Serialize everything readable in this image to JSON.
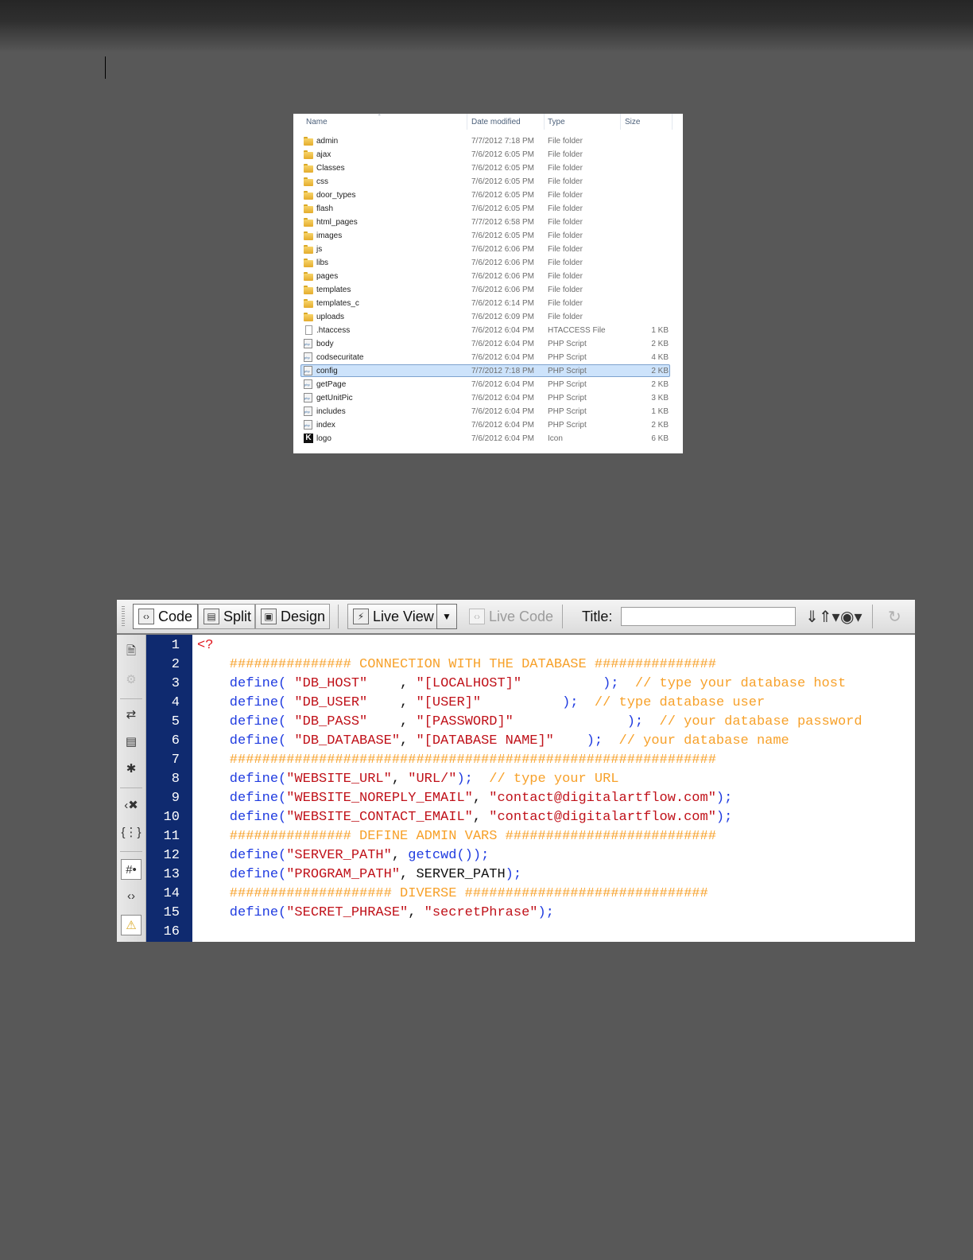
{
  "explorer": {
    "columns": [
      "Name",
      "Date modified",
      "Type",
      "Size"
    ],
    "rows": [
      {
        "name": "admin",
        "date": "7/7/2012 7:18 PM",
        "type": "File folder",
        "size": "",
        "icon": "folder-icon"
      },
      {
        "name": "ajax",
        "date": "7/6/2012 6:05 PM",
        "type": "File folder",
        "size": "",
        "icon": "folder-icon"
      },
      {
        "name": "Classes",
        "date": "7/6/2012 6:05 PM",
        "type": "File folder",
        "size": "",
        "icon": "folder-icon"
      },
      {
        "name": "css",
        "date": "7/6/2012 6:05 PM",
        "type": "File folder",
        "size": "",
        "icon": "folder-icon"
      },
      {
        "name": "door_types",
        "date": "7/6/2012 6:05 PM",
        "type": "File folder",
        "size": "",
        "icon": "folder-icon"
      },
      {
        "name": "flash",
        "date": "7/6/2012 6:05 PM",
        "type": "File folder",
        "size": "",
        "icon": "folder-icon"
      },
      {
        "name": "html_pages",
        "date": "7/7/2012 6:58 PM",
        "type": "File folder",
        "size": "",
        "icon": "folder-icon"
      },
      {
        "name": "images",
        "date": "7/6/2012 6:05 PM",
        "type": "File folder",
        "size": "",
        "icon": "folder-icon"
      },
      {
        "name": "js",
        "date": "7/6/2012 6:06 PM",
        "type": "File folder",
        "size": "",
        "icon": "folder-icon"
      },
      {
        "name": "libs",
        "date": "7/6/2012 6:06 PM",
        "type": "File folder",
        "size": "",
        "icon": "folder-icon"
      },
      {
        "name": "pages",
        "date": "7/6/2012 6:06 PM",
        "type": "File folder",
        "size": "",
        "icon": "folder-icon"
      },
      {
        "name": "templates",
        "date": "7/6/2012 6:06 PM",
        "type": "File folder",
        "size": "",
        "icon": "folder-icon"
      },
      {
        "name": "templates_c",
        "date": "7/6/2012 6:14 PM",
        "type": "File folder",
        "size": "",
        "icon": "folder-icon"
      },
      {
        "name": "uploads",
        "date": "7/6/2012 6:09 PM",
        "type": "File folder",
        "size": "",
        "icon": "folder-icon"
      },
      {
        "name": ".htaccess",
        "date": "7/6/2012 6:04 PM",
        "type": "HTACCESS File",
        "size": "1 KB",
        "icon": "file-icon"
      },
      {
        "name": "body",
        "date": "7/6/2012 6:04 PM",
        "type": "PHP Script",
        "size": "2 KB",
        "icon": "php-file-icon"
      },
      {
        "name": "codsecuritate",
        "date": "7/6/2012 6:04 PM",
        "type": "PHP Script",
        "size": "4 KB",
        "icon": "php-file-icon"
      },
      {
        "name": "config",
        "date": "7/7/2012 7:18 PM",
        "type": "PHP Script",
        "size": "2 KB",
        "icon": "php-file-icon",
        "selected": true
      },
      {
        "name": "getPage",
        "date": "7/6/2012 6:04 PM",
        "type": "PHP Script",
        "size": "2 KB",
        "icon": "php-file-icon"
      },
      {
        "name": "getUnitPic",
        "date": "7/6/2012 6:04 PM",
        "type": "PHP Script",
        "size": "3 KB",
        "icon": "php-file-icon"
      },
      {
        "name": "includes",
        "date": "7/6/2012 6:04 PM",
        "type": "PHP Script",
        "size": "1 KB",
        "icon": "php-file-icon"
      },
      {
        "name": "index",
        "date": "7/6/2012 6:04 PM",
        "type": "PHP Script",
        "size": "2 KB",
        "icon": "php-file-icon"
      },
      {
        "name": "logo",
        "date": "7/6/2012 6:04 PM",
        "type": "Icon",
        "size": "6 KB",
        "icon": "logo-icon"
      }
    ]
  },
  "toolbar": {
    "code_label": "Code",
    "split_label": "Split",
    "design_label": "Design",
    "live_view_label": "Live View",
    "live_code_label": "Live Code",
    "title_label": "Title:",
    "title_value": ""
  },
  "editor": {
    "line_numbers": [
      "1",
      "2",
      "3",
      "4",
      "5",
      "6",
      "7",
      "8",
      "9",
      "10",
      "11",
      "12",
      "13",
      "14",
      "15",
      "16"
    ],
    "lines": [
      [
        {
          "t": "tag",
          "v": "<?"
        }
      ],
      [
        {
          "t": "cm",
          "v": "    ############### CONNECTION WITH THE DATABASE ###############"
        }
      ],
      [
        {
          "t": "kw",
          "v": "    define( "
        },
        {
          "t": "str",
          "v": "\"DB_HOST\""
        },
        {
          "t": "pl",
          "v": "    , "
        },
        {
          "t": "str",
          "v": "\"[LOCALHOST]\""
        },
        {
          "t": "kw",
          "v": "          );"
        },
        {
          "t": "cm",
          "v": "  // type your database host"
        }
      ],
      [
        {
          "t": "kw",
          "v": "    define( "
        },
        {
          "t": "str",
          "v": "\"DB_USER\""
        },
        {
          "t": "pl",
          "v": "    , "
        },
        {
          "t": "str",
          "v": "\"[USER]\""
        },
        {
          "t": "kw",
          "v": "          );"
        },
        {
          "t": "cm",
          "v": "  // type database user"
        }
      ],
      [
        {
          "t": "kw",
          "v": "    define( "
        },
        {
          "t": "str",
          "v": "\"DB_PASS\""
        },
        {
          "t": "pl",
          "v": "    , "
        },
        {
          "t": "str",
          "v": "\"[PASSWORD]\""
        },
        {
          "t": "kw",
          "v": "              );"
        },
        {
          "t": "cm",
          "v": "  // your database password"
        }
      ],
      [
        {
          "t": "kw",
          "v": "    define( "
        },
        {
          "t": "str",
          "v": "\"DB_DATABASE\""
        },
        {
          "t": "pl",
          "v": ", "
        },
        {
          "t": "str",
          "v": "\"[DATABASE NAME]\""
        },
        {
          "t": "kw",
          "v": "    );"
        },
        {
          "t": "cm",
          "v": "  // your database name"
        }
      ],
      [
        {
          "t": "cm",
          "v": "    ############################################################"
        }
      ],
      [
        {
          "t": "kw",
          "v": "    define("
        },
        {
          "t": "str",
          "v": "\"WEBSITE_URL\""
        },
        {
          "t": "pl",
          "v": ", "
        },
        {
          "t": "str",
          "v": "\"URL/\""
        },
        {
          "t": "kw",
          "v": ");"
        },
        {
          "t": "cm",
          "v": "  // type your URL"
        }
      ],
      [
        {
          "t": "kw",
          "v": "    define("
        },
        {
          "t": "str",
          "v": "\"WEBSITE_NOREPLY_EMAIL\""
        },
        {
          "t": "pl",
          "v": ", "
        },
        {
          "t": "str",
          "v": "\"contact@digitalartflow.com\""
        },
        {
          "t": "kw",
          "v": ");"
        }
      ],
      [
        {
          "t": "kw",
          "v": "    define("
        },
        {
          "t": "str",
          "v": "\"WEBSITE_CONTACT_EMAIL\""
        },
        {
          "t": "pl",
          "v": ", "
        },
        {
          "t": "str",
          "v": "\"contact@digitalartflow.com\""
        },
        {
          "t": "kw",
          "v": ");"
        }
      ],
      [
        {
          "t": "cm",
          "v": "    ############### DEFINE ADMIN VARS ##########################"
        }
      ],
      [
        {
          "t": "kw",
          "v": "    define("
        },
        {
          "t": "str",
          "v": "\"SERVER_PATH\""
        },
        {
          "t": "pl",
          "v": ", "
        },
        {
          "t": "kw",
          "v": "getcwd());"
        }
      ],
      [
        {
          "t": "kw",
          "v": "    define("
        },
        {
          "t": "str",
          "v": "\"PROGRAM_PATH\""
        },
        {
          "t": "pl",
          "v": ", SERVER_PATH"
        },
        {
          "t": "kw",
          "v": ");"
        }
      ],
      [
        {
          "t": "cm",
          "v": "    #################### DIVERSE ##############################"
        }
      ],
      [
        {
          "t": "kw",
          "v": "    define("
        },
        {
          "t": "str",
          "v": "\"SECRET_PHRASE\""
        },
        {
          "t": "pl",
          "v": ", "
        },
        {
          "t": "str",
          "v": "\"secretPhrase\""
        },
        {
          "t": "kw",
          "v": ");"
        }
      ],
      []
    ]
  }
}
